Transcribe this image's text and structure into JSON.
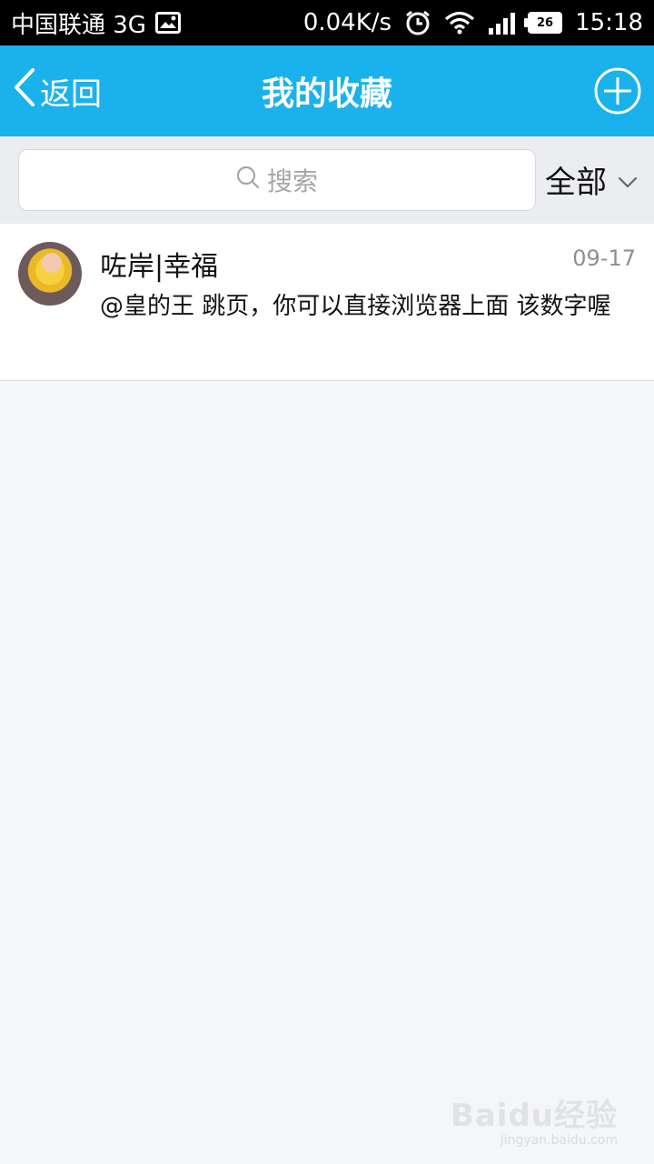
{
  "status_bar": {
    "carrier": "中国联通 3G",
    "speed": "0.04K/s",
    "battery": "26",
    "time": "15:18",
    "icons": [
      "image-icon",
      "alarm-icon",
      "wifi-icon",
      "signal-icon",
      "battery-icon"
    ]
  },
  "header": {
    "back_label": "返回",
    "title": "我的收藏",
    "add_icon": "plus-circle-icon",
    "color": "#1ab2ec"
  },
  "search": {
    "placeholder": "搜索",
    "filter_label": "全部"
  },
  "items": [
    {
      "name": "咗岸|幸福",
      "date": "09-17",
      "message": "@皇的王  跳页，你可以直接浏览器上面 该数字喔"
    }
  ],
  "watermark": {
    "logo": "Baidu经验",
    "url": "jingyan.baidu.com"
  }
}
